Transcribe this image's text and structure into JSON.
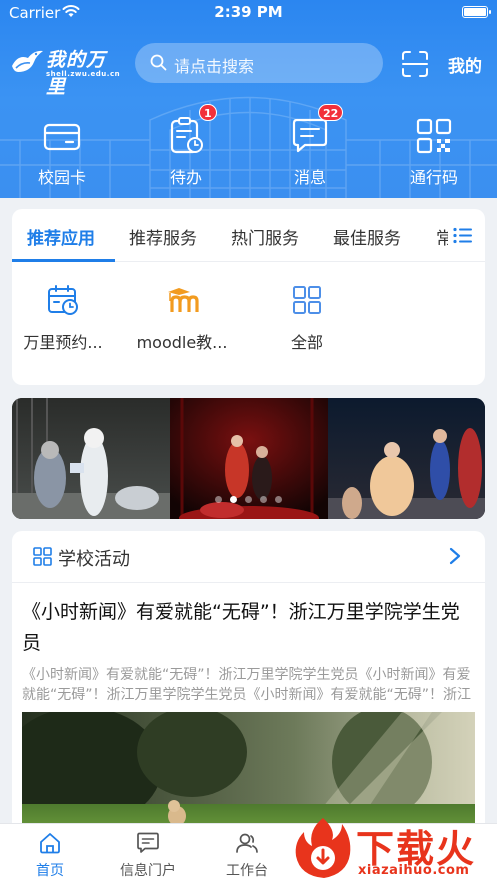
{
  "status_bar": {
    "carrier": "Carrier",
    "time": "2:39 PM"
  },
  "header": {
    "logo_text": "我的万里",
    "logo_url": "shell.zwu.edu.cn",
    "search_placeholder": "请点击搜索",
    "mine_label": "我的",
    "brand_color": "#3a8ff0",
    "quick_actions": [
      {
        "label": "校园卡",
        "icon": "card-icon",
        "badge": ""
      },
      {
        "label": "待办",
        "icon": "todo-icon",
        "badge": "1"
      },
      {
        "label": "消息",
        "icon": "message-icon",
        "badge": "22"
      },
      {
        "label": "通行码",
        "icon": "qrcode-icon",
        "badge": ""
      }
    ]
  },
  "apps_card": {
    "tabs": [
      "推荐应用",
      "推荐服务",
      "热门服务",
      "最佳服务"
    ],
    "active_tab": "推荐应用",
    "apps": [
      {
        "label": "万里预约...",
        "icon": "calendar-clock-icon"
      },
      {
        "label": "moodle教...",
        "icon": "moodle-icon"
      },
      {
        "label": "全部",
        "icon": "grid-icon"
      }
    ]
  },
  "banner": {
    "slide_count": 5,
    "active_slide": 2
  },
  "activities": {
    "section_title": "学校活动",
    "news_title": "《小时新闻》有爱就能“无碍”！浙江万里学院学生党员",
    "news_summary": "《小时新闻》有爱就能“无碍”！浙江万里学院学生党员《小时新闻》有爱就能“无碍”！浙江万里学院学生党员《小时新闻》有爱就能“无碍”！浙江万里学院学生党员"
  },
  "tabbar": {
    "items": [
      {
        "label": "首页",
        "icon": "home-icon",
        "active": true
      },
      {
        "label": "信息门户",
        "icon": "info-portal-icon",
        "active": false
      },
      {
        "label": "工作台",
        "icon": "workbench-icon",
        "active": false
      }
    ]
  },
  "watermark": {
    "text": "下载火",
    "url": "xiazaihuo.com",
    "color": "#e8341c"
  }
}
